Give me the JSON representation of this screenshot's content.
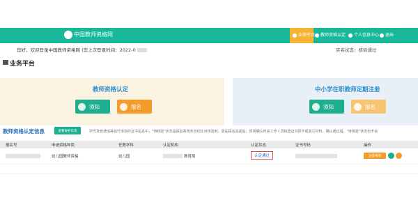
{
  "header": {
    "site_name": "中国教师资格网",
    "nav": [
      {
        "label": "业务平台",
        "active": true
      },
      {
        "label": "教师资格认定",
        "active": false
      },
      {
        "label": "个人信息中心",
        "active": false
      },
      {
        "label": "退出",
        "active": false
      }
    ]
  },
  "welcome": {
    "text": "您好，欢迎登录中国教师资格网 (您上次登录时间：2022-0",
    "status": "实名状态：核验通过"
  },
  "section": {
    "title": "业务平台"
  },
  "cards": [
    {
      "title": "教师资格认定",
      "buttons": [
        "须知",
        "报名"
      ]
    },
    {
      "title": "中小学在职教师定期注册",
      "buttons": [
        "须知",
        "报名"
      ]
    }
  ],
  "info": {
    "title": "教师资格认定信息",
    "view_button": "查看报名信息",
    "notice": "学历及普通话等自行添加的证书信息中，\"待核验\"状态指报名系统未自动比对核验到，需在报名完成后，现场确认时由工作人员核查证书原件或其它材料。确认通过后，\"待核验\"状态也不会"
  },
  "table": {
    "headers": [
      "报名号",
      "申请资格种类",
      "任教学科",
      "认定机构",
      "认定状态",
      "证书号码",
      "操作"
    ],
    "rows": [
      {
        "qualification": "幼儿园教师资格",
        "subject": "幼儿园",
        "agency": "教育局",
        "status": "认定通过",
        "action": "注意事项"
      }
    ]
  },
  "colors": {
    "banner": "#19b89b",
    "accent_orange": "#f39c2b",
    "link_blue": "#2f8fd0",
    "status_border": "#e04b3b"
  }
}
